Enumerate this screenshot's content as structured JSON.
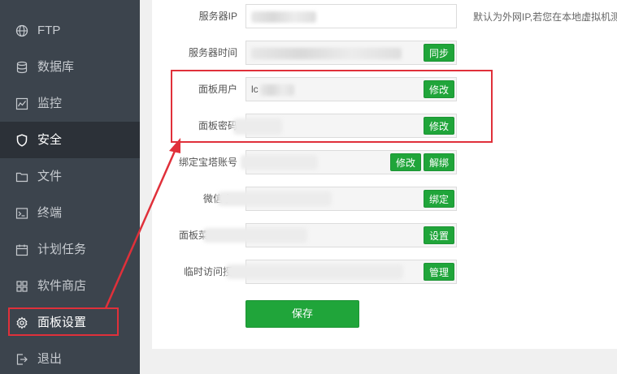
{
  "sidebar": {
    "items": [
      {
        "label": "FTP",
        "icon": "globe-icon"
      },
      {
        "label": "数据库",
        "icon": "database-icon"
      },
      {
        "label": "监控",
        "icon": "monitor-icon"
      },
      {
        "label": "安全",
        "icon": "shield-icon"
      },
      {
        "label": "文件",
        "icon": "folder-icon"
      },
      {
        "label": "终端",
        "icon": "terminal-icon"
      },
      {
        "label": "计划任务",
        "icon": "calendar-icon"
      },
      {
        "label": "软件商店",
        "icon": "grid-icon"
      },
      {
        "label": "面板设置",
        "icon": "gear-icon"
      },
      {
        "label": "退出",
        "icon": "logout-icon"
      }
    ],
    "active": "安全"
  },
  "settings": {
    "server_ip": {
      "label": "服务器IP",
      "hint": "默认为外网IP,若您在本地虚拟机测"
    },
    "server_time": {
      "label": "服务器时间",
      "button": "同步"
    },
    "panel_user": {
      "label": "面板用户",
      "value": "lc",
      "button": "修改"
    },
    "panel_password": {
      "label": "面板密码",
      "button": "修改"
    },
    "bind_account": {
      "label": "绑定宝塔账号",
      "button_edit": "修改",
      "button_unbind": "解绑"
    },
    "wechat": {
      "label": "微信小",
      "button": "绑定"
    },
    "panel_menu": {
      "label": "面板菜",
      "button": "设置"
    },
    "temp_access": {
      "label": "临时访问授",
      "button": "管理"
    },
    "save": "保存"
  },
  "colors": {
    "sidebar_bg": "#3c444d",
    "sidebar_active": "#2c3138",
    "accent_green": "#20a53a",
    "annotation_red": "#e0303a"
  }
}
